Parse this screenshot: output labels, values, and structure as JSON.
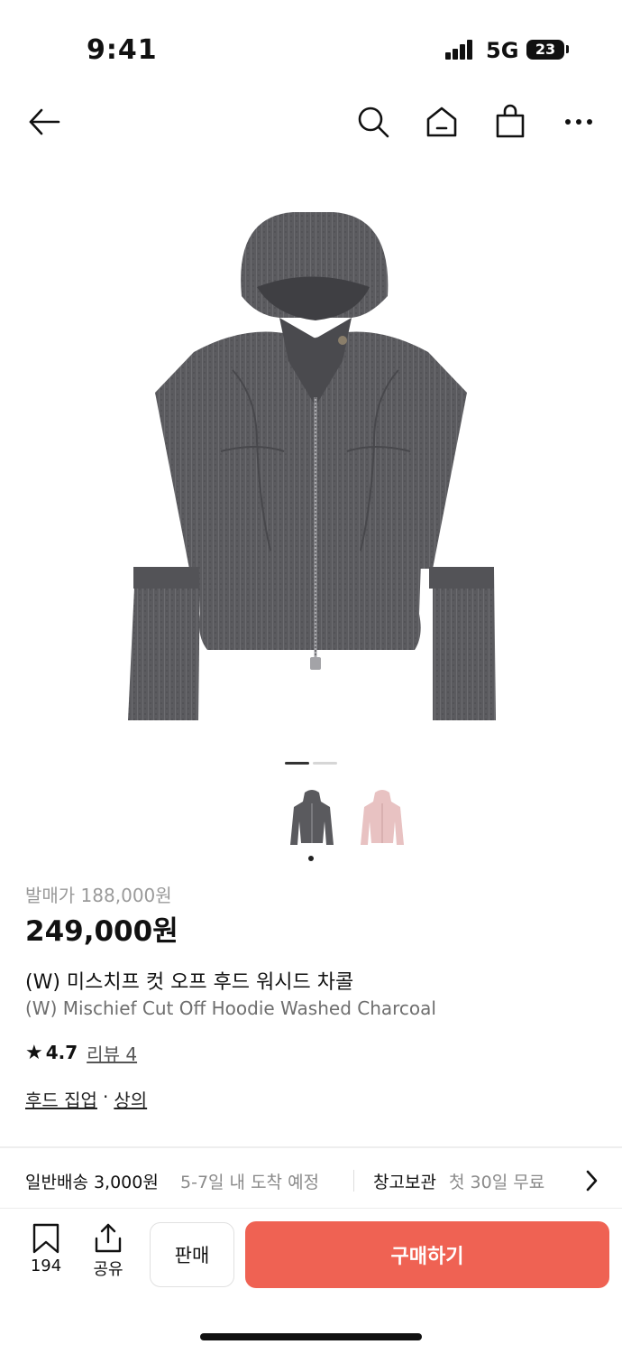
{
  "status_bar": {
    "time": "9:41",
    "network": "5G",
    "battery": "23"
  },
  "nav": {
    "icons": [
      "back-arrow-icon",
      "search-icon",
      "home-icon",
      "shopping-bag-icon",
      "more-icon"
    ]
  },
  "colors": {
    "accent": "#ef6253",
    "garment_charcoal": "#5a5a5e",
    "garment_pink": "#e8c2c2"
  },
  "gallery": {
    "current_page": 1,
    "total_pages": 2,
    "selected_color_index": 0
  },
  "product": {
    "release_price_label": "발매가 188,000원",
    "price": "249,000원",
    "name_ko": "(W) 미스치프 컷 오프 후드 워시드 차콜",
    "name_en": "(W) Mischief Cut Off Hoodie Washed Charcoal",
    "rating": "4.7",
    "reviews": "리뷰 4",
    "category_1": "후드 집업",
    "category_sep": "·",
    "category_2": "상의"
  },
  "delivery": {
    "shipping": "일반배송 3,000원",
    "eta": "5-7일 내 도착 예정",
    "storage": "창고보관",
    "storage_note": "첫 30일 무료"
  },
  "actions": {
    "bookmark_count": "194",
    "share_label": "공유",
    "sell_label": "판매",
    "buy_label": "구매하기"
  }
}
